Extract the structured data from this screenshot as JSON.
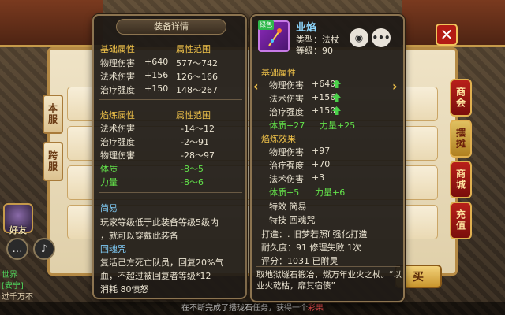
{
  "left_panel": {
    "title": "装备详情",
    "base": {
      "heading": "基础属性",
      "range_heading": "属性范围",
      "rows": [
        {
          "label": "物理伤害",
          "value": "+640",
          "range": "577～742"
        },
        {
          "label": "法术伤害",
          "value": "+156",
          "range": "126～166"
        },
        {
          "label": "治疗强度",
          "value": "+150",
          "range": "148～267"
        }
      ]
    },
    "refine": {
      "heading": "焰炼属性",
      "range_heading": "属性范围",
      "rows": [
        {
          "label": "法术伤害",
          "range": "-14～12"
        },
        {
          "label": "治疗强度",
          "range": "-2～91"
        },
        {
          "label": "物理伤害",
          "range": "-28～97"
        },
        {
          "label": "体质",
          "range": "-8～5"
        },
        {
          "label": "力量",
          "range": "-8～6"
        }
      ]
    },
    "intro_heading": "简易",
    "intro_lines": [
      "玩家等级低于此装备等级5级内",
      "，就可以穿戴此装备"
    ],
    "skill_heading": "回魂咒",
    "skill_lines": [
      "复活己方死亡队员，回复20%气",
      "血，不超过被回复者等级*12",
      "消耗 80愤怒"
    ]
  },
  "right_panel": {
    "badge": "绿色",
    "name": "业焰",
    "type_line": "类型：法杖",
    "level_line": "等级：90",
    "base_heading": "基础属性",
    "base_rows": [
      {
        "label": "物理伤害",
        "value": "+640"
      },
      {
        "label": "法术伤害",
        "value": "+156"
      },
      {
        "label": "治疗强度",
        "value": "+150"
      }
    ],
    "base_green": [
      "体质+27",
      "力量+25"
    ],
    "refine_heading": "焰炼效果",
    "refine_rows": [
      {
        "label": "物理伤害",
        "value": "+97"
      },
      {
        "label": "治疗强度",
        "value": "+70"
      },
      {
        "label": "法术伤害",
        "value": "+3"
      }
    ],
    "refine_green": [
      "体质+5",
      "力量+6"
    ],
    "effect_line": "特效  简易",
    "skill_line": "特技  回魂咒",
    "forge_line": "打造：. 旧梦若照ǐ  强化打造",
    "durability_line": "耐久度：91  修理失败 1次",
    "score_line": "评分：1031  已附灵",
    "description": "取地狱燧石锻冶，燃万年业火之杖。“以业火乾枯，靡其宿债”"
  },
  "side_tabs": [
    "本服",
    "跨服"
  ],
  "right_tabs": [
    "商会",
    "摆摊",
    "商城",
    "充值"
  ],
  "left_avatars": [
    {
      "label": "好友"
    }
  ],
  "chat": {
    "line1": "世界",
    "line2": "[安宁]",
    "line3": "过千万不"
  },
  "buy_label": "买",
  "ticker": {
    "prefix": "在不断完成了搭珑石任务，获得一个",
    "highlight": "彩果"
  }
}
